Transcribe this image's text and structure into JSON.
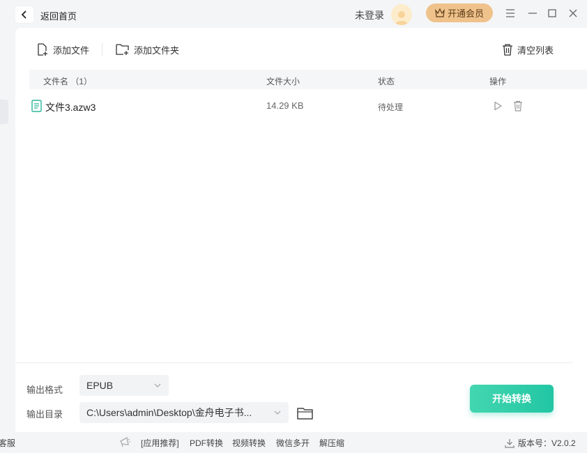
{
  "titlebar": {
    "back_label": "返回首页",
    "login_text": "未登录",
    "vip_label": "开通会员"
  },
  "toolbar": {
    "add_file": "添加文件",
    "add_folder": "添加文件夹",
    "clear_list": "清空列表"
  },
  "table": {
    "headers": {
      "name": "文件名 （1）",
      "size": "文件大小",
      "status": "状态",
      "action": "操作"
    },
    "rows": [
      {
        "name": "文件3.azw3",
        "size": "14.29 KB",
        "status": "待处理"
      }
    ]
  },
  "output": {
    "format_label": "输出格式",
    "format_value": "EPUB",
    "dir_label": "输出目录",
    "dir_value": "C:\\Users\\admin\\Desktop\\金舟电子书...",
    "convert_label": "开始转换"
  },
  "footer": {
    "left_cut": "客服",
    "links": [
      "[应用推荐]",
      "PDF转换",
      "视频转换",
      "微信多开",
      "解压缩"
    ],
    "version": "版本号：V2.0.2"
  },
  "colors": {
    "accent_green": "#22c6a4",
    "vip_gold": "#efc28c",
    "file_icon": "#2bb598"
  }
}
